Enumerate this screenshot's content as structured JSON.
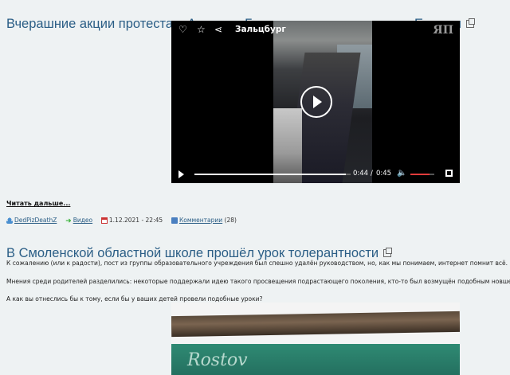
{
  "post1": {
    "title": "Вчерашние акции протеста в Австрии, Германии и других странах Европы",
    "video": {
      "location": "Зальцбург",
      "logo": "ЯП",
      "current_time": "0:44",
      "separator": "/",
      "duration": "0:45",
      "progress_fraction": 0.97,
      "volume_fraction": 0.8,
      "icons": [
        "heart-icon",
        "star-icon",
        "share-icon",
        "play-icon",
        "volume-icon",
        "fullscreen-icon"
      ]
    },
    "read_more": "Читать дальше...",
    "meta": {
      "author": "DedPizDeathZ",
      "category": "Видео",
      "date": "1.12.2021 - 22:45",
      "comments_label": "Комментарии",
      "comments_count": "(28)"
    }
  },
  "post2": {
    "title": "В Смоленской областной школе прошёл урок толерантности",
    "paragraphs": [
      "К сожалению (или к радости), пост из группы образовательного учреждения был спешно удалён руководством, но, как мы понимаем, интернет помнит всё.",
      "Мнения среди родителей разделились: некоторые поддержали идею такого просвещения подрастающего поколения, кто-то был возмущён подобным новшеством.",
      "А как вы отнеслись бы к тому, если бы у ваших детей провели подобные уроки?"
    ],
    "photo_sign": "Rostov"
  },
  "colors": {
    "background": "#eef2f3",
    "title": "#2b5e86",
    "volume": "#e23b3b"
  }
}
